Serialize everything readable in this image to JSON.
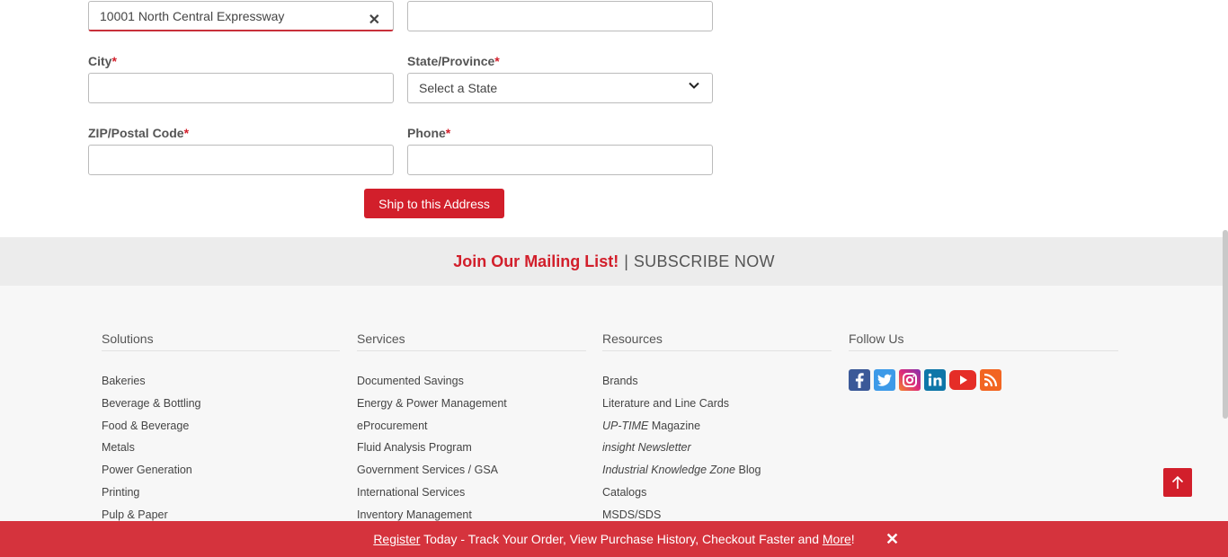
{
  "form": {
    "address_value": "10001 North Central Expressway",
    "address2_value": "",
    "city_label": "City",
    "state_label": "State/Province",
    "state_selected": "Select a State",
    "zip_label": "ZIP/Postal Code",
    "phone_label": "Phone",
    "required_mark": "*",
    "ship_button": "Ship to this Address"
  },
  "mailing": {
    "join": "Join Our Mailing List!",
    "separator": "|",
    "subscribe": "SUBSCRIBE NOW"
  },
  "footer": {
    "solutions": {
      "title": "Solutions",
      "items": [
        "Bakeries",
        "Beverage & Bottling",
        "Food & Beverage",
        "Metals",
        "Power Generation",
        "Printing",
        "Pulp & Paper"
      ]
    },
    "services": {
      "title": "Services",
      "items": [
        "Documented Savings",
        "Energy & Power Management",
        "eProcurement",
        "Fluid Analysis Program",
        "Government Services / GSA",
        "International Services",
        "Inventory Management"
      ]
    },
    "resources": {
      "title": "Resources",
      "items": [
        {
          "italic": "",
          "text": "Brands"
        },
        {
          "italic": "",
          "text": "Literature and Line Cards"
        },
        {
          "italic": "UP-TIME",
          "text": " Magazine"
        },
        {
          "italic": "insight Newsletter",
          "text": ""
        },
        {
          "italic": "Industrial Knowledge Zone",
          "text": " Blog"
        },
        {
          "italic": "",
          "text": "Catalogs"
        },
        {
          "italic": "",
          "text": "MSDS/SDS"
        }
      ]
    },
    "follow": {
      "title": "Follow Us",
      "icons": [
        "facebook-icon",
        "twitter-icon",
        "instagram-icon",
        "linkedin-icon",
        "youtube-icon",
        "rss-icon"
      ]
    }
  },
  "register_bar": {
    "register_link": "Register",
    "middle_text": " Today - Track Your Order, View Purchase History, Checkout Faster and ",
    "more_link": "More",
    "end_text": "!",
    "close": "✕"
  },
  "colors": {
    "brand_red": "#d21f2b",
    "footer_bg": "#f7f7f7",
    "mailing_bg": "#ececec"
  }
}
